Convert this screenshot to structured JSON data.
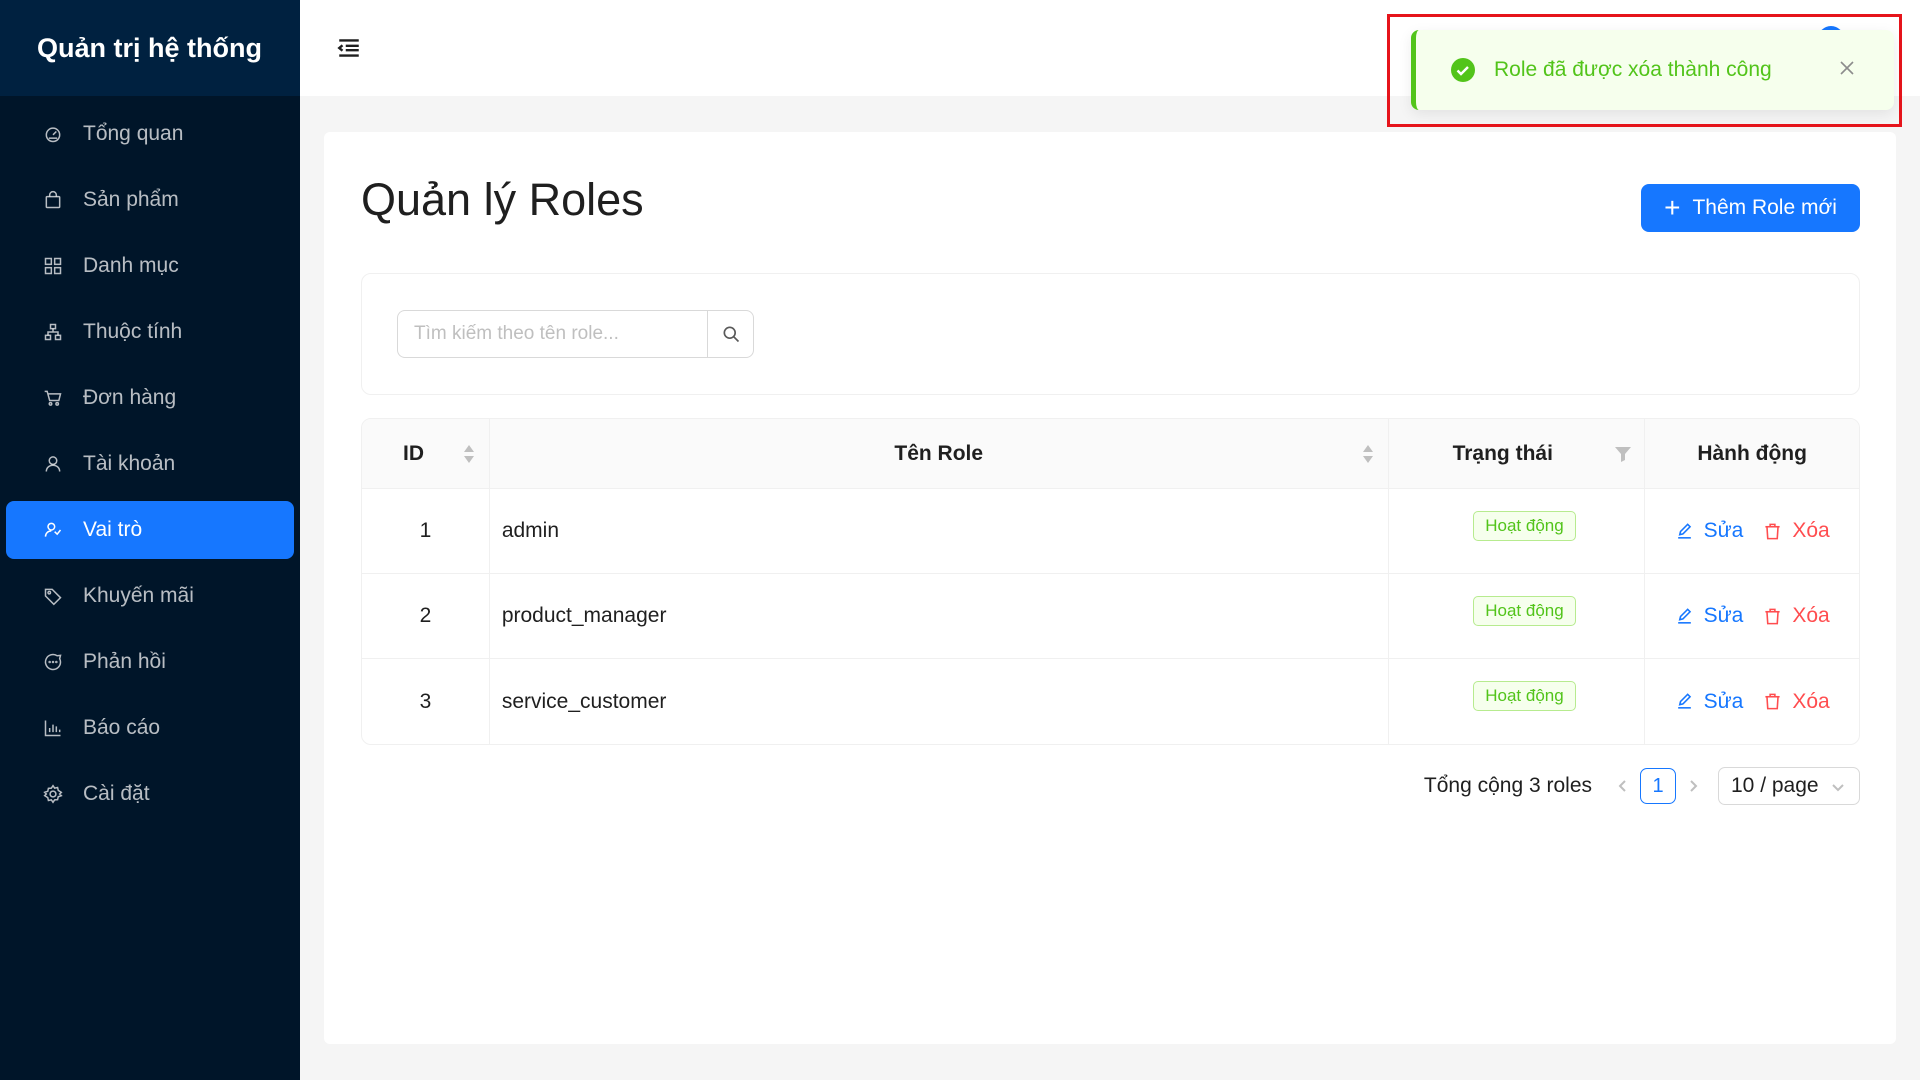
{
  "sidebar": {
    "brand": "Quản trị hệ thống",
    "items": [
      {
        "label": "Tổng quan",
        "icon": "dashboard-icon"
      },
      {
        "label": "Sản phẩm",
        "icon": "shopping-bag-icon"
      },
      {
        "label": "Danh mục",
        "icon": "grid-icon"
      },
      {
        "label": "Thuộc tính",
        "icon": "hierarchy-icon"
      },
      {
        "label": "Đơn hàng",
        "icon": "cart-icon"
      },
      {
        "label": "Tài khoản",
        "icon": "user-icon"
      },
      {
        "label": "Vai trò",
        "icon": "user-group-icon",
        "active": true
      },
      {
        "label": "Khuyến mãi",
        "icon": "tag-icon"
      },
      {
        "label": "Phản hồi",
        "icon": "message-icon"
      },
      {
        "label": "Báo cáo",
        "icon": "bar-chart-icon"
      },
      {
        "label": "Cài đặt",
        "icon": "gear-icon"
      }
    ]
  },
  "header": {
    "toggle_icon": "menu-fold-icon"
  },
  "toast": {
    "message": "Role đã được xóa thành công",
    "icon": "check-circle-icon",
    "close_icon": "close-icon",
    "color": "#52c41a"
  },
  "main": {
    "title": "Quản lý Roles",
    "add_button": "Thêm Role mới",
    "search": {
      "placeholder": "Tìm kiếm theo tên role...",
      "value": ""
    },
    "table": {
      "columns": [
        "ID",
        "Tên Role",
        "Trạng thái",
        "Hành động"
      ],
      "rows": [
        {
          "id": "1",
          "name": "admin",
          "status": "Hoạt động",
          "edit": "Sửa",
          "delete": "Xóa"
        },
        {
          "id": "2",
          "name": "product_manager",
          "status": "Hoạt động",
          "edit": "Sửa",
          "delete": "Xóa"
        },
        {
          "id": "3",
          "name": "service_customer",
          "status": "Hoạt động",
          "edit": "Sửa",
          "delete": "Xóa"
        }
      ]
    },
    "pagination": {
      "total_text": "Tổng cộng 3 roles",
      "current_page": "1",
      "page_size": "10 / page"
    }
  },
  "colors": {
    "primary": "#1677ff",
    "sidebar_bg": "#001529",
    "danger": "#ff4d4f",
    "success": "#52c41a",
    "highlight_outline": "#e6141b"
  }
}
